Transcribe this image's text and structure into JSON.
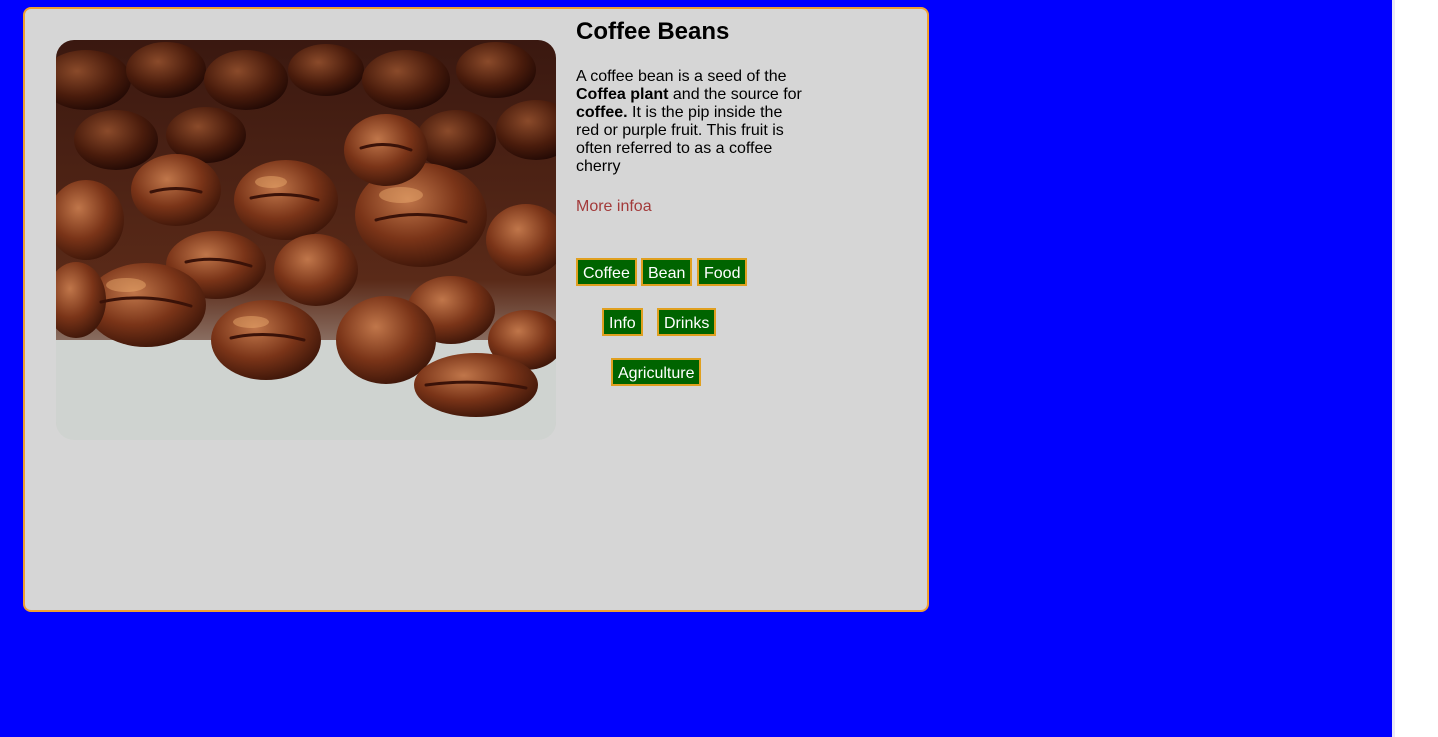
{
  "card": {
    "title": "Coffee Beans",
    "image_alt": "Roasted coffee beans",
    "description": {
      "p1": "A coffee bean is a seed of the ",
      "b1": "Coffea plant",
      "p2": " and the source for ",
      "b2": "coffee.",
      "p3": " It is the pip inside the red or purple fruit. This fruit is often referred to as a coffee cherry"
    },
    "more_link": "More infoa",
    "tags": [
      "Coffee",
      "Bean",
      "Food",
      "Info",
      "Drinks",
      "Agriculture"
    ]
  },
  "colors": {
    "page_background": "#0000ff",
    "card_background": "#d6d6d6",
    "card_border": "#f0a030",
    "tag_background": "#006400",
    "tag_border": "#e0a020",
    "link": "#a33a3a"
  }
}
